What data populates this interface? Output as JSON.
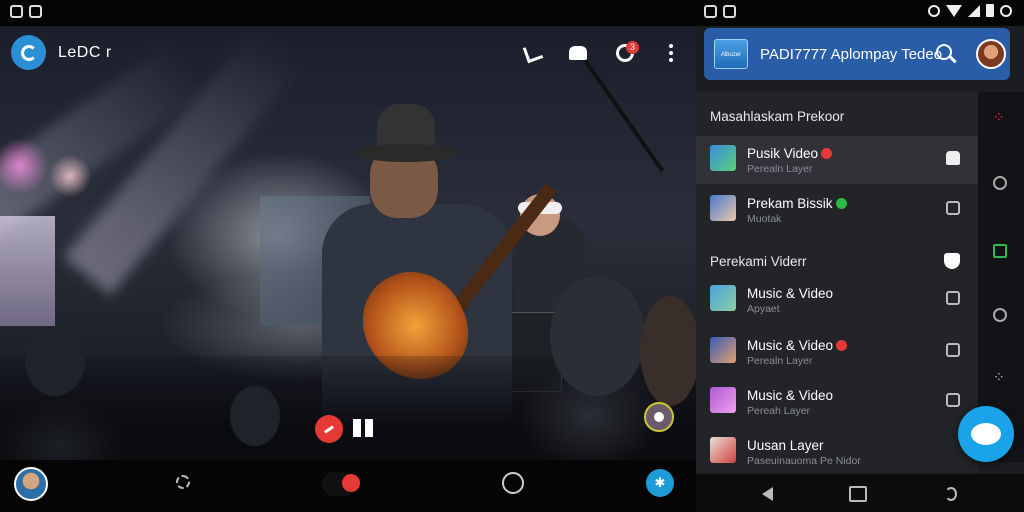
{
  "video": {
    "title": "LeDC r"
  },
  "panel": {
    "header_title": "PADI7777 Aplompay Tedeo",
    "logo_text": "Albuzer"
  },
  "sections": [
    {
      "title": "Masahlaskam Prekoor"
    },
    {
      "title": "Perekami Viderr"
    }
  ],
  "items": [
    {
      "title": "Pusik Video",
      "subtitle": "Perealn Layer",
      "badge": "red",
      "active": true,
      "thumb_color": "#3a8be0"
    },
    {
      "title": "Prekam Bissik",
      "subtitle": "Muotak",
      "badge": "green",
      "active": false,
      "thumb_color": "#4a7ad0"
    },
    {
      "title": "Music & Video",
      "subtitle": "Apyaet",
      "badge": "",
      "active": false,
      "thumb_color": "#4aa0e0"
    },
    {
      "title": "Music & Video",
      "subtitle": "Perealn Layer",
      "badge": "red",
      "active": false,
      "thumb_color": "#3a5ab8"
    },
    {
      "title": "Music & Video",
      "subtitle": "Pereah Layer",
      "badge": "",
      "active": false,
      "thumb_color": "#b05ad0"
    },
    {
      "title": "Uusan Layer",
      "subtitle": "Paseuinauoma Pe Nidor",
      "badge": "",
      "active": false,
      "thumb_color": "#e8e0d8"
    }
  ],
  "notifications": {
    "count": "3"
  },
  "colors": {
    "accent": "#1aa3e8",
    "header": "#2a5da8",
    "record": "#e53935",
    "panel_bg": "#222428"
  }
}
